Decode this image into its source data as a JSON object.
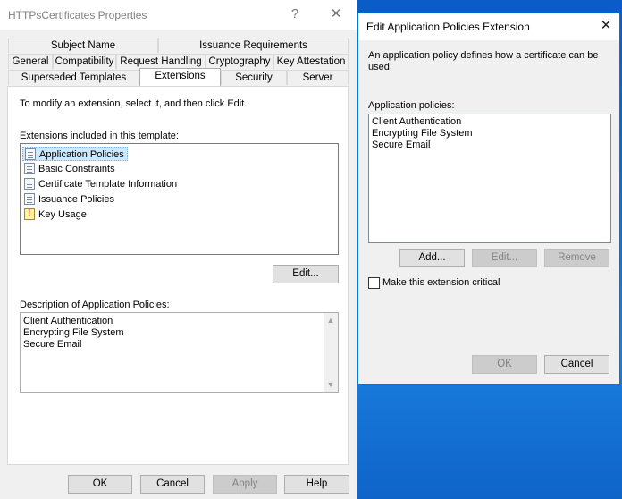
{
  "dialog1": {
    "title": "HTTPsCertificates Properties",
    "help_glyph": "?",
    "close_glyph": "✕",
    "tabs_row1": [
      "Subject Name",
      "Issuance Requirements"
    ],
    "tabs_row2": [
      "General",
      "Compatibility",
      "Request Handling",
      "Cryptography",
      "Key Attestation"
    ],
    "tabs_row3": [
      "Superseded Templates",
      "Extensions",
      "Security",
      "Server"
    ],
    "instruction": "To modify an extension, select it, and then click Edit.",
    "extensions_label": "Extensions included in this template:",
    "extensions": [
      "Application Policies",
      "Basic Constraints",
      "Certificate Template Information",
      "Issuance Policies",
      "Key Usage"
    ],
    "edit_button": "Edit...",
    "description_label": "Description of Application Policies:",
    "description_lines": [
      "Client Authentication",
      "Encrypting File System",
      "Secure Email"
    ],
    "scroll_up": "▲",
    "scroll_down": "▼",
    "buttons": {
      "ok": "OK",
      "cancel": "Cancel",
      "apply": "Apply",
      "help": "Help"
    }
  },
  "dialog2": {
    "title": "Edit Application Policies Extension",
    "close_glyph": "✕",
    "description": "An application policy defines how a certificate can be used.",
    "policies_label": "Application policies:",
    "policies": [
      "Client Authentication",
      "Encrypting File System",
      "Secure Email"
    ],
    "buttons": {
      "add": "Add...",
      "edit": "Edit...",
      "remove": "Remove",
      "ok": "OK",
      "cancel": "Cancel"
    },
    "critical_checkbox_label": "Make this extension critical",
    "critical_checked": false
  }
}
